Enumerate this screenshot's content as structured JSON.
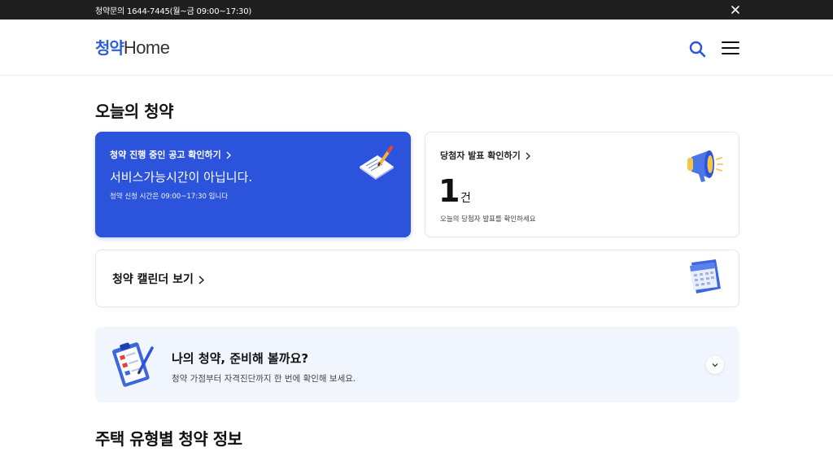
{
  "topbar": {
    "notice": "청약문의 1644-7445(월~금 09:00~17:30)"
  },
  "header": {
    "logo_kr": "청약",
    "logo_en": "Home"
  },
  "today": {
    "title": "오늘의 청약",
    "apply_card": {
      "link": "청약 진행 중인 공고 확인하기",
      "headline": "서비스가능시간이 아닙니다.",
      "sub": "청약 신청 시간은 09:00~17:30 입니다"
    },
    "winner_card": {
      "link": "당첨자 발표 확인하기",
      "count": "1",
      "unit": "건",
      "sub": "오늘의 당첨자 발표를 확인하세요"
    },
    "calendar_card": {
      "link": "청약 캘린더 보기"
    }
  },
  "prep": {
    "title": "나의 청약, 준비해 볼까요?",
    "sub": "청약 가점부터 자격진단까지 한 번에 확인해 보세요."
  },
  "housing": {
    "title": "주택 유형별 청약 정보"
  },
  "colors": {
    "primary": "#2c53dc",
    "topbar": "#1f1f1f",
    "prep_bg": "#f1f5fd"
  }
}
